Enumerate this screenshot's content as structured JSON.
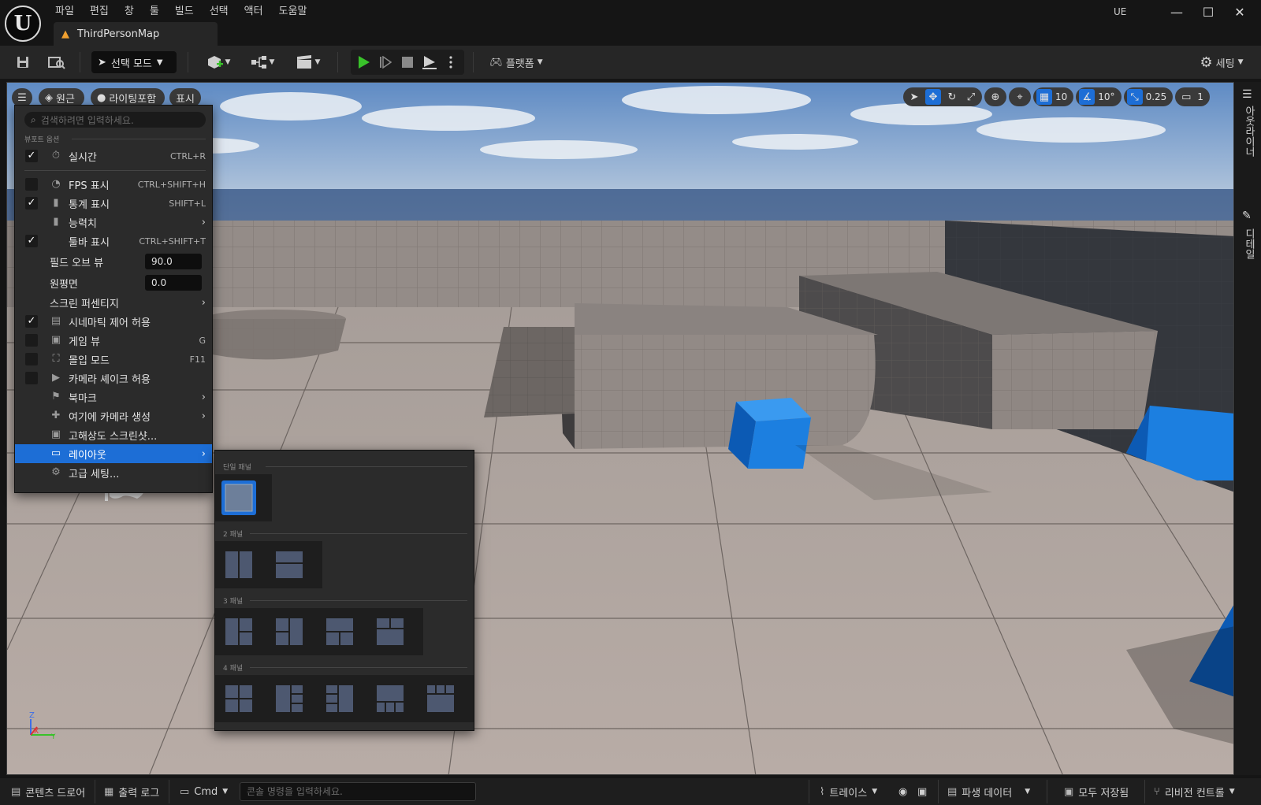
{
  "menubar": [
    "파일",
    "편집",
    "창",
    "툴",
    "빌드",
    "선택",
    "액터",
    "도움말"
  ],
  "tab": {
    "title": "ThirdPersonMap"
  },
  "window": {
    "app_label": "UE",
    "minimize": "—",
    "maximize": "☐",
    "close": "✕"
  },
  "toolbar": {
    "select_mode": "선택 모드",
    "platform": "플랫폼",
    "settings": "세팅"
  },
  "viewport": {
    "perspective": "원근",
    "lighting": "라이팅포함",
    "show": "표시",
    "grid_snap": "10",
    "rotation_snap": "10°",
    "scale_snap": "0.25",
    "camera_speed": "1"
  },
  "side_panels": {
    "outliner": "아웃라이너",
    "details": "디테일"
  },
  "menu": {
    "search_placeholder": "검색하려면 입력하세요.",
    "section_title": "뷰포트 옵션",
    "items": [
      {
        "label": "실시간",
        "shortcut": "CTRL+R",
        "checked": true
      },
      {
        "label": "FPS 표시",
        "shortcut": "CTRL+SHIFT+H",
        "checked": false
      },
      {
        "label": "통계 표시",
        "shortcut": "SHIFT+L",
        "checked": true
      },
      {
        "label": "능력치",
        "shortcut": "",
        "checked": null
      },
      {
        "label": "툴바 표시",
        "shortcut": "CTRL+SHIFT+T",
        "checked": true
      },
      {
        "label": "필드 오브 뷰",
        "value": "90.0"
      },
      {
        "label": "원평면",
        "value": "0.0"
      },
      {
        "label": "스크린 퍼센티지"
      },
      {
        "label": "시네마틱 제어 허용",
        "checked": true
      },
      {
        "label": "게임 뷰",
        "shortcut": "G",
        "checked": false
      },
      {
        "label": "몰입 모드",
        "shortcut": "F11",
        "checked": false
      },
      {
        "label": "카메라 셰이크 허용",
        "checked": false
      },
      {
        "label": "북마크"
      },
      {
        "label": "여기에 카메라 생성"
      },
      {
        "label": "고해상도 스크린샷..."
      },
      {
        "label": "레이아웃",
        "selected": true
      },
      {
        "label": "고급 세팅..."
      }
    ]
  },
  "layout_submenu": {
    "sections": [
      "단일 패널",
      "2 패널",
      "3 패널",
      "4 패널"
    ]
  },
  "statusbar": {
    "content_drawer": "콘텐츠 드로어",
    "output_log": "출력 로그",
    "cmd": "Cmd",
    "console_placeholder": "콘솔 명령을 입력하세요.",
    "trace": "트레이스",
    "derived_data": "파생 데이터",
    "save_all": "모두 저장됨",
    "revision_control": "리비전 컨트롤"
  },
  "colors": {
    "accent": "#1d6ed6",
    "play": "#39c22a",
    "cube": "#1c7fe0"
  }
}
